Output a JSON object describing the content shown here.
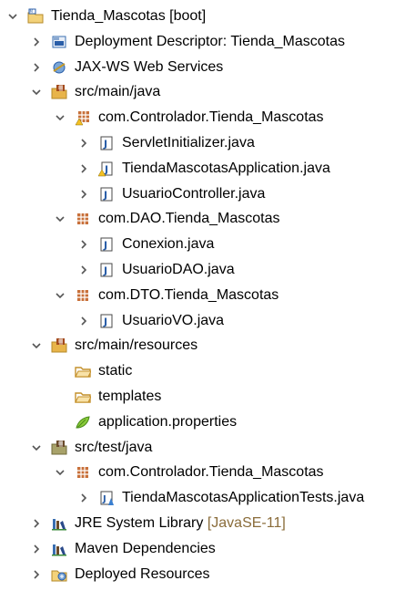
{
  "colors": {
    "twisty": "#555555",
    "decoration": "#8a6c3a",
    "package": "#8b4a1c",
    "folder": "#e8b44a",
    "java_file": "#2a5ea8",
    "library": "#3a6fb0"
  },
  "project_tree": {
    "rows": [
      {
        "depth": 0,
        "twisty": "expanded",
        "icon": "project-folder-icon",
        "label": "Tienda_Mascotas [boot]",
        "decoration": ""
      },
      {
        "depth": 1,
        "twisty": "collapsed",
        "icon": "deployment-descriptor-icon",
        "label": "Deployment Descriptor: Tienda_Mascotas",
        "decoration": ""
      },
      {
        "depth": 1,
        "twisty": "collapsed",
        "icon": "web-services-icon",
        "label": "JAX-WS Web Services",
        "decoration": ""
      },
      {
        "depth": 1,
        "twisty": "expanded",
        "icon": "source-folder-icon",
        "label": "src/main/java",
        "decoration": ""
      },
      {
        "depth": 2,
        "twisty": "expanded",
        "icon": "package-warning-icon",
        "label": "com.Controlador.Tienda_Mascotas",
        "decoration": ""
      },
      {
        "depth": 3,
        "twisty": "collapsed",
        "icon": "java-file-icon",
        "label": "ServletInitializer.java",
        "decoration": ""
      },
      {
        "depth": 3,
        "twisty": "collapsed",
        "icon": "java-file-warning-icon",
        "label": "TiendaMascotasApplication.java",
        "decoration": ""
      },
      {
        "depth": 3,
        "twisty": "collapsed",
        "icon": "java-file-icon",
        "label": "UsuarioController.java",
        "decoration": ""
      },
      {
        "depth": 2,
        "twisty": "expanded",
        "icon": "package-icon",
        "label": "com.DAO.Tienda_Mascotas",
        "decoration": ""
      },
      {
        "depth": 3,
        "twisty": "collapsed",
        "icon": "java-file-icon",
        "label": "Conexion.java",
        "decoration": ""
      },
      {
        "depth": 3,
        "twisty": "collapsed",
        "icon": "java-file-icon",
        "label": "UsuarioDAO.java",
        "decoration": ""
      },
      {
        "depth": 2,
        "twisty": "expanded",
        "icon": "package-icon",
        "label": "com.DTO.Tienda_Mascotas",
        "decoration": ""
      },
      {
        "depth": 3,
        "twisty": "collapsed",
        "icon": "java-file-icon",
        "label": "UsuarioVO.java",
        "decoration": ""
      },
      {
        "depth": 1,
        "twisty": "expanded",
        "icon": "source-folder-icon",
        "label": "src/main/resources",
        "decoration": ""
      },
      {
        "depth": 2,
        "twisty": "none",
        "icon": "folder-icon",
        "label": "static",
        "decoration": ""
      },
      {
        "depth": 2,
        "twisty": "none",
        "icon": "folder-icon",
        "label": "templates",
        "decoration": ""
      },
      {
        "depth": 2,
        "twisty": "none",
        "icon": "properties-file-icon",
        "label": "application.properties",
        "decoration": ""
      },
      {
        "depth": 1,
        "twisty": "expanded",
        "icon": "test-source-folder-icon",
        "label": "src/test/java",
        "decoration": ""
      },
      {
        "depth": 2,
        "twisty": "expanded",
        "icon": "package-icon",
        "label": "com.Controlador.Tienda_Mascotas",
        "decoration": ""
      },
      {
        "depth": 3,
        "twisty": "collapsed",
        "icon": "java-test-file-icon",
        "label": "TiendaMascotasApplicationTests.java",
        "decoration": ""
      },
      {
        "depth": 1,
        "twisty": "collapsed",
        "icon": "library-icon",
        "label": "JRE System Library",
        "decoration": "[JavaSE-11]"
      },
      {
        "depth": 1,
        "twisty": "collapsed",
        "icon": "library-icon",
        "label": "Maven Dependencies",
        "decoration": ""
      },
      {
        "depth": 1,
        "twisty": "collapsed",
        "icon": "deployed-resources-icon",
        "label": "Deployed Resources",
        "decoration": ""
      }
    ]
  }
}
